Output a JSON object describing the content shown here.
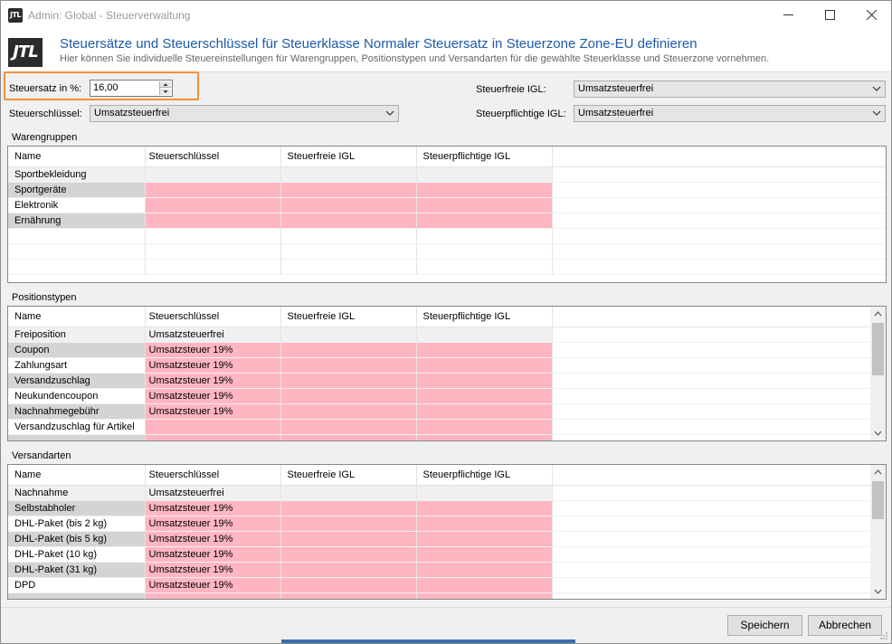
{
  "window": {
    "title": "Admin: Global - Steuerverwaltung",
    "app_icon_text": "JTL"
  },
  "header": {
    "logo_text": "JTL",
    "title": "Steuersätze und Steuerschlüssel für Steuerklasse Normaler Steuersatz in Steuerzone Zone-EU definieren",
    "subtitle": "Hier können Sie individuelle Steuereinstellungen für Warengruppen, Positionstypen und Versandarten für die gewählte Steuerklasse und Steuerzone vornehmen."
  },
  "form": {
    "steuersatz_label": "Steuersatz in %:",
    "steuersatz_value": "16,00",
    "steuerschluessel_label": "Steuerschlüssel:",
    "steuerschluessel_value": "Umsatzsteuerfrei",
    "steuerfreie_igl_label": "Steuerfreie IGL:",
    "steuerfreie_igl_value": "Umsatzsteuerfrei",
    "steuerpflichtige_igl_label": "Steuerpflichtige IGL:",
    "steuerpflichtige_igl_value": "Umsatzsteuerfrei"
  },
  "columns": [
    "Name",
    "Steuerschlüssel",
    "Steuerfreie IGL",
    "Steuerpflichtige IGL"
  ],
  "warengruppen": {
    "title": "Warengruppen",
    "rows": [
      {
        "name": "Sportbekleidung",
        "key": "",
        "style": "gray"
      },
      {
        "name": "Sportgeräte",
        "key": "",
        "style": "shade-pink"
      },
      {
        "name": "Elektronik",
        "key": "",
        "style": "plain-pink"
      },
      {
        "name": "Ernährung",
        "key": "",
        "style": "shade-pink"
      }
    ]
  },
  "positionstypen": {
    "title": "Positionstypen",
    "rows": [
      {
        "name": "Freiposition",
        "key": "Umsatzsteuerfrei",
        "style": "gray"
      },
      {
        "name": "Coupon",
        "key": "Umsatzsteuer 19%",
        "style": "shade-pink"
      },
      {
        "name": "Zahlungsart",
        "key": "Umsatzsteuer 19%",
        "style": "plain-pink"
      },
      {
        "name": "Versandzuschlag",
        "key": "Umsatzsteuer 19%",
        "style": "shade-pink"
      },
      {
        "name": "Neukundencoupon",
        "key": "Umsatzsteuer 19%",
        "style": "plain-pink"
      },
      {
        "name": "Nachnahmegebühr",
        "key": "Umsatzsteuer 19%",
        "style": "shade-pink"
      },
      {
        "name": "Versandzuschlag für Artikel",
        "key": "",
        "style": "plain-pink"
      }
    ]
  },
  "versandarten": {
    "title": "Versandarten",
    "rows": [
      {
        "name": "Nachnahme",
        "key": "Umsatzsteuerfrei",
        "style": "gray"
      },
      {
        "name": "Selbstabholer",
        "key": "Umsatzsteuer 19%",
        "style": "shade-pink"
      },
      {
        "name": "DHL-Paket (bis 2 kg)",
        "key": "Umsatzsteuer 19%",
        "style": "plain-pink"
      },
      {
        "name": "DHL-Paket (bis 5 kg)",
        "key": "Umsatzsteuer 19%",
        "style": "shade-pink"
      },
      {
        "name": "DHL-Paket (10 kg)",
        "key": "Umsatzsteuer 19%",
        "style": "plain-pink"
      },
      {
        "name": "DHL-Paket (31 kg)",
        "key": "Umsatzsteuer 19%",
        "style": "shade-pink"
      },
      {
        "name": "DPD",
        "key": "Umsatzsteuer 19%",
        "style": "plain-pink"
      }
    ]
  },
  "buttons": {
    "save": "Speichern",
    "cancel": "Abbrechen"
  },
  "colors": {
    "accent_title": "#1e5aa8",
    "highlight": "#f0913a",
    "pink": "#ffb6c1"
  }
}
